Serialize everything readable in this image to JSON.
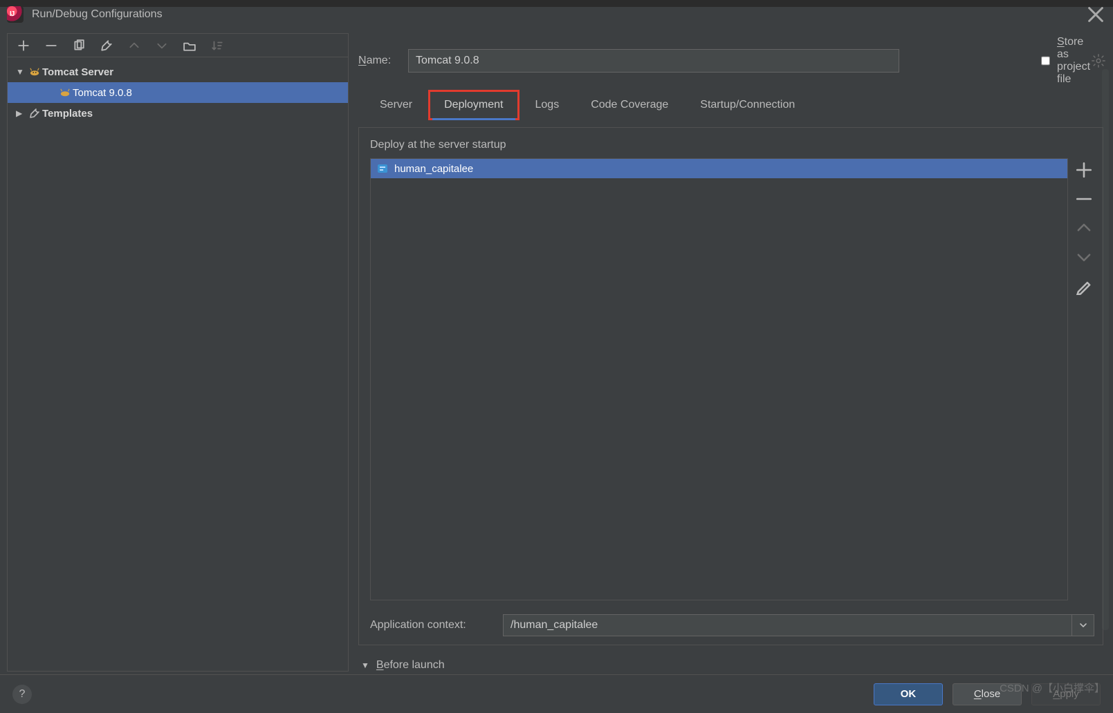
{
  "dialog": {
    "title": "Run/Debug Configurations",
    "store_label_pre": "S",
    "store_label_rest": "tore as project file"
  },
  "name_row": {
    "label_pre": "N",
    "label_rest": "ame:",
    "value": "Tomcat 9.0.8"
  },
  "tabs": [
    {
      "label": "Server"
    },
    {
      "label": "Deployment",
      "active": true
    },
    {
      "label": "Logs"
    },
    {
      "label": "Code Coverage"
    },
    {
      "label": "Startup/Connection"
    }
  ],
  "deployment": {
    "section_label": "Deploy at the server startup",
    "artifacts": [
      {
        "label": "human_capitalee"
      }
    ],
    "context_label": "Application context:",
    "context_value": "/human_capitalee"
  },
  "before_launch": {
    "label_pre": "B",
    "label_rest": "efore launch"
  },
  "tree": {
    "nodes": [
      {
        "label": "Tomcat Server",
        "type": "group",
        "icon": "tomcat"
      },
      {
        "label": "Tomcat 9.0.8",
        "type": "child",
        "icon": "tomcat",
        "selected": true
      },
      {
        "label": "Templates",
        "type": "group",
        "icon": "wrench"
      }
    ]
  },
  "footer": {
    "ok": "OK",
    "close_pre": "C",
    "close_rest": "lose",
    "apply_pre": "A",
    "apply_rest": "pply"
  },
  "watermark": "CSDN @【小白撑伞】"
}
